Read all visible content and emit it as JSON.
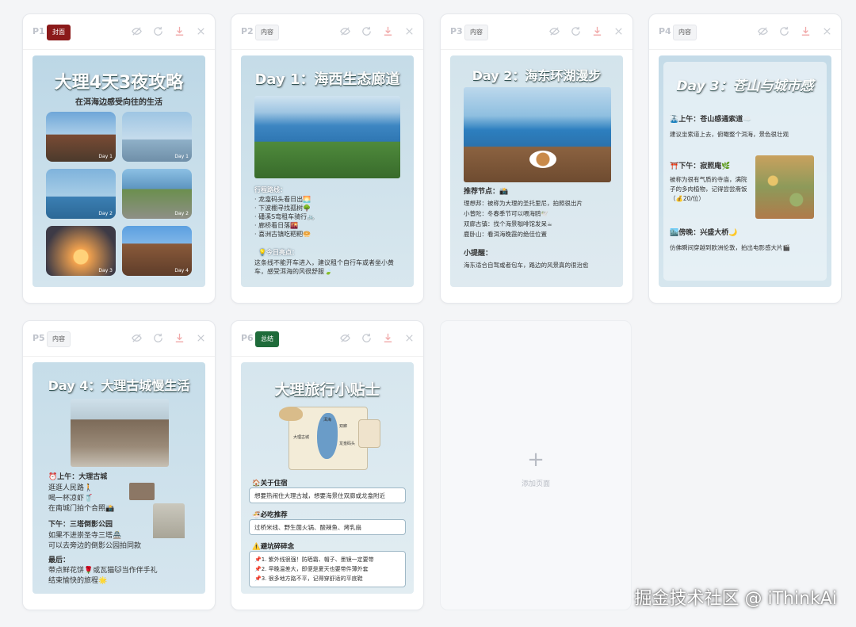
{
  "cards": [
    {
      "num": "P1",
      "tag": "封面"
    },
    {
      "num": "P2",
      "tag": "内容"
    },
    {
      "num": "P3",
      "tag": "内容"
    },
    {
      "num": "P4",
      "tag": "内容"
    },
    {
      "num": "P5",
      "tag": "内容"
    },
    {
      "num": "P6",
      "tag": "总结"
    }
  ],
  "p1": {
    "title": "大理4天3夜攻略",
    "subtitle": "在洱海边感受向往的生活",
    "tiles": [
      "Day 1",
      "Day 1",
      "Day 2",
      "Day 2",
      "Day 3",
      "Day 4"
    ]
  },
  "p2": {
    "title": "Day 1：海西生态廊道",
    "route_label": "行程路线：",
    "route": [
      "· 龙龛码头看日出🌅",
      "· 下波棚寻找孤树🌳",
      "· 磻溪S弯租车骑行🚲",
      "· 廊桥看日落🌇",
      "· 喜洲古镇吃粑粑🥯"
    ],
    "tip_label": "💡今日亮点：",
    "tip": "这条线不能开车进入，建议租个自行车或者坐小黄车，感受洱海的风很舒服🍃"
  },
  "p3": {
    "title": "Day 2：海东环湖漫步",
    "rec_label": "推荐节点：📸",
    "rec": [
      "理想邦：被称为大理的圣托里尼，拍照很出片",
      "小普陀：冬春季节可以喂海鸥🕊️",
      "双廊古镇：找个海景咖啡馆发呆☕",
      "鹿卧山：看洱海晚霞的绝佳位置"
    ],
    "hint_label": "小提醒：",
    "hint": "海东适合自驾或者包车，路边的风景真的很治愈"
  },
  "p4": {
    "title": "Day 3：苍山与城市感",
    "am_label": "🚠上午：苍山感通索道☁️",
    "am": "建议坐索道上去，俯瞰整个洱海，景色很壮观",
    "pm_label": "⛩️下午：寂照庵🌿",
    "pm": "被称为很有气质的寺庙，满院子的多肉植物，记得尝尝斋饭（💰20/位）",
    "eve_label": "🏙️傍晚：兴盛大桥🌙",
    "eve": "仿佛瞬间穿越到欧洲伦敦，拍出电影感大片🎬"
  },
  "p5": {
    "title": "Day 4：大理古城慢生活",
    "am_label": "⏰上午：大理古城",
    "am": [
      "逛逛人民路🚶",
      "喝一杯凉虾🥤",
      "在南城门拍个合照📸"
    ],
    "pm_label": "下午：三塔倒影公园",
    "pm": [
      "如果不进崇圣寺三塔🏯",
      "可以去旁边的倒影公园拍同款"
    ],
    "last_label": "最后：",
    "last": [
      "带点鲜花饼🌹或瓦猫🐱当作伴手礼",
      "结束愉快的旅程🌟"
    ]
  },
  "p6": {
    "title": "大理旅行小贴士",
    "map_labels": [
      "大理古城",
      "洱海",
      "龙龛码头",
      "双廊"
    ],
    "stay_label": "🏠关于住宿",
    "stay": "想要热闹住大理古城，想要海景住双廊或龙龛附近",
    "food_label": "🍜必吃推荐",
    "food": "过桥米线、野生菌火锅、酸辣鱼、烤乳扇",
    "pit_label": "⚠️避坑碎碎念",
    "pits": [
      "📌1. 紫外线很强！防晒霜、帽子、墨镜一定要带",
      "📌2. 早晚温差大，即便是夏天也要带件薄外套",
      "📌3. 很多地方路不平，记得穿舒适的平底鞋"
    ]
  },
  "add_label": "添加页面",
  "watermark": "掘金技术社区 @ iThinkAi"
}
